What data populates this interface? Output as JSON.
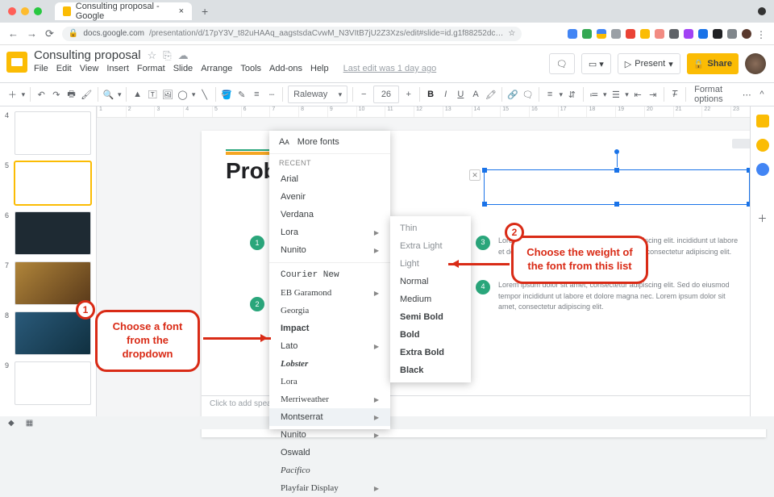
{
  "browser": {
    "tab_title": "Consulting proposal - Google",
    "url_host": "docs.google.com",
    "url_path": "/presentation/d/17pY3V_t82uHAAq_aagstsdaCvwM_N3VItB7jU2Z3Xzs/edit#slide=id.g1f88252dc…",
    "star": "☆"
  },
  "doc": {
    "title": "Consulting proposal",
    "menus": [
      "File",
      "Edit",
      "View",
      "Insert",
      "Format",
      "Slide",
      "Arrange",
      "Tools",
      "Add-ons",
      "Help"
    ],
    "last_edit": "Last edit was 1 day ago",
    "present": "Present",
    "share": "Share"
  },
  "toolbar": {
    "font": "Raleway",
    "size": "26",
    "format_options": "Format options"
  },
  "dropdown": {
    "more_fonts": "More fonts",
    "recent_label": "RECENT",
    "recent": [
      {
        "name": "Arial",
        "sub": false
      },
      {
        "name": "Avenir",
        "sub": false
      },
      {
        "name": "Verdana",
        "sub": false
      },
      {
        "name": "Lora",
        "sub": true
      },
      {
        "name": "Nunito",
        "sub": true
      }
    ],
    "all": [
      {
        "name": "Courier New",
        "cls": "f-courier",
        "sub": false
      },
      {
        "name": "EB Garamond",
        "cls": "f-serif",
        "sub": true
      },
      {
        "name": "Georgia",
        "cls": "f-georgia",
        "sub": false
      },
      {
        "name": "Impact",
        "cls": "f-impact",
        "sub": false
      },
      {
        "name": "Lato",
        "cls": "",
        "sub": true
      },
      {
        "name": "Lobster",
        "cls": "f-lob",
        "sub": false
      },
      {
        "name": "Lora",
        "cls": "f-serif",
        "sub": false
      },
      {
        "name": "Merriweather",
        "cls": "f-serif",
        "sub": true
      },
      {
        "name": "Montserrat",
        "cls": "",
        "sub": true,
        "hi": true
      },
      {
        "name": "Nunito",
        "cls": "",
        "sub": true
      },
      {
        "name": "Oswald",
        "cls": "",
        "sub": false
      },
      {
        "name": "Pacifico",
        "cls": "f-script",
        "sub": false
      },
      {
        "name": "Playfair Display",
        "cls": "f-serif",
        "sub": true
      }
    ],
    "weights": [
      "Thin",
      "Extra Light",
      "Light",
      "Normal",
      "Medium",
      "Semi Bold",
      "Bold",
      "Extra Bold",
      "Black"
    ]
  },
  "slide": {
    "title": "Prob",
    "lorem1": "Lorem ipsum dolor sit amet, consectetur adipiscing elit. incididunt ut labore et dolore magna. Lorem ipsum dolor sit amet, consectetur adipiscing elit.",
    "lorem2": "Lorem ipsum dolor sit amet, consectetur adipiscing elit. Sed do eiusmod tempor incididunt ut labore et dolore magna nec. Lorem ipsum dolor sit amet, consectetur adipiscing elit."
  },
  "notes": "Click to add speaker notes",
  "callouts": {
    "c1": "Choose a font from the dropdown",
    "c2": "Choose the weight of the font from this list"
  },
  "thumbs": [
    4,
    5,
    6,
    7,
    8,
    9
  ]
}
